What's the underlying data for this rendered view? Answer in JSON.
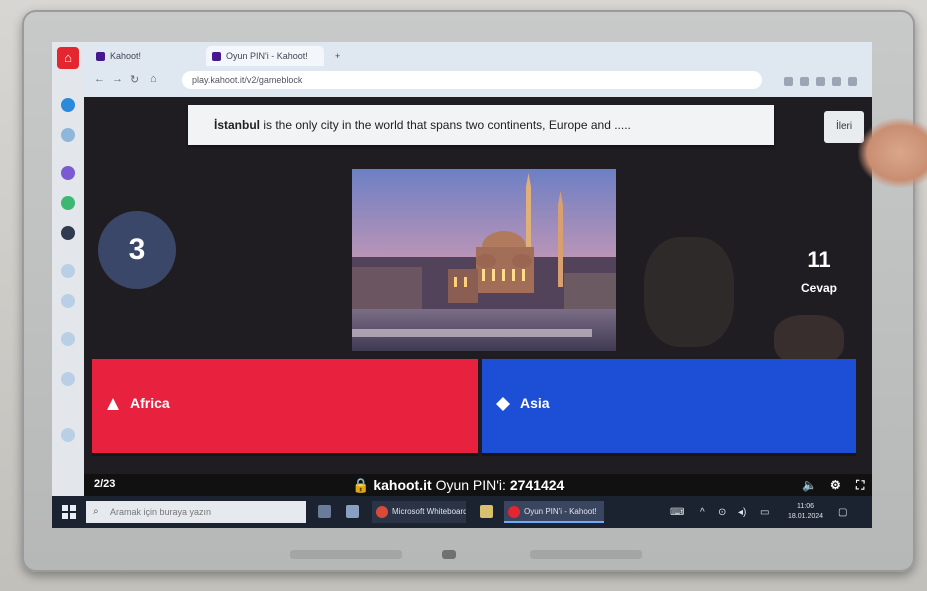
{
  "browser": {
    "tabs": [
      {
        "label": "Kahoot!",
        "active": false
      },
      {
        "label": "Oyun PIN'i - Kahoot!",
        "active": true
      }
    ],
    "url": "play.kahoot.it/v2/gameblock"
  },
  "question": {
    "highlight": "İstanbul",
    "text": " is the only city in the world that spans two continents, Europe and ....."
  },
  "next_label": "İleri",
  "timer": "3",
  "answers_count": {
    "value": "11",
    "label": "Cevap"
  },
  "answers": [
    {
      "label": "Africa",
      "shape": "triangle",
      "color": "#e8213f"
    },
    {
      "label": "Asia",
      "shape": "diamond",
      "color": "#1c4fd6"
    }
  ],
  "footer": {
    "question_count": "2/23",
    "brand": "kahoot.it",
    "pin_label": "Oyun PIN'i:",
    "pin": "2741424"
  },
  "taskbar": {
    "search_placeholder": "Aramak için buraya yazın",
    "apps": [
      "Microsoft Whiteboard",
      "Oyun PIN'i - Kahoot!"
    ],
    "clock_time": "11:06",
    "clock_date": "18.01.2024"
  },
  "colors": {
    "answer_red": "#e8213f",
    "answer_blue": "#1c4fd6",
    "timer_bg": "#3b4768",
    "oem_accent": "#e3262f"
  },
  "icons": [
    "oem-logo-icon",
    "lock-icon",
    "volume-icon",
    "settings-icon",
    "fullscreen-icon",
    "windows-start-icon",
    "search-icon"
  ]
}
